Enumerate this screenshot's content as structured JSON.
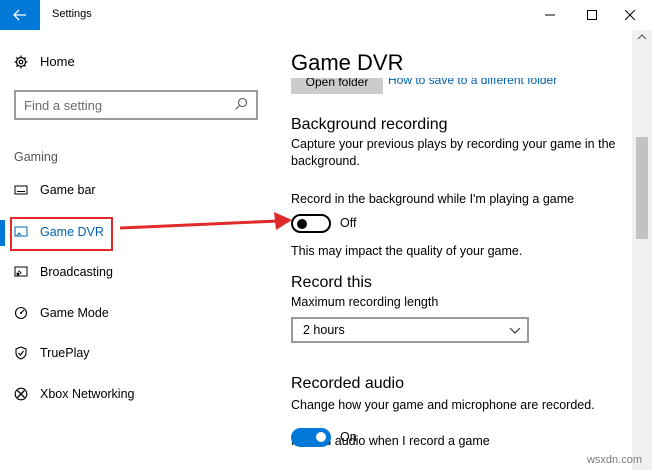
{
  "window": {
    "title": "Settings"
  },
  "sidebar": {
    "home_label": "Home",
    "search_placeholder": "Find a setting",
    "section_label": "Gaming",
    "items": [
      {
        "label": "Game bar",
        "icon": "game-bar-icon"
      },
      {
        "label": "Game DVR",
        "icon": "game-dvr-icon",
        "selected": true
      },
      {
        "label": "Broadcasting",
        "icon": "broadcasting-icon"
      },
      {
        "label": "Game Mode",
        "icon": "game-mode-icon"
      },
      {
        "label": "TruePlay",
        "icon": "trueplay-icon"
      },
      {
        "label": "Xbox Networking",
        "icon": "xbox-icon"
      }
    ]
  },
  "main": {
    "title": "Game DVR",
    "open_folder_label": "Open folder",
    "folder_link": "How to save to a different folder",
    "background": {
      "heading": "Background recording",
      "description": "Capture your previous plays by recording your game in the background.",
      "toggle_caption": "Record in the background while I'm playing a game",
      "toggle_state": "Off",
      "note": "This may impact the quality of your game."
    },
    "record_this": {
      "heading": "Record this",
      "length_label": "Maximum recording length",
      "length_value": "2 hours"
    },
    "recorded_audio": {
      "heading": "Recorded audio",
      "description": "Change how your game and microphone are recorded.",
      "toggle_caption": "Record audio when I record a game",
      "toggle_state": "On"
    }
  },
  "watermark": "wsxdn.com",
  "colors": {
    "accent": "#0078d7",
    "link": "#0063b1",
    "annotation": "#e02b2b"
  }
}
